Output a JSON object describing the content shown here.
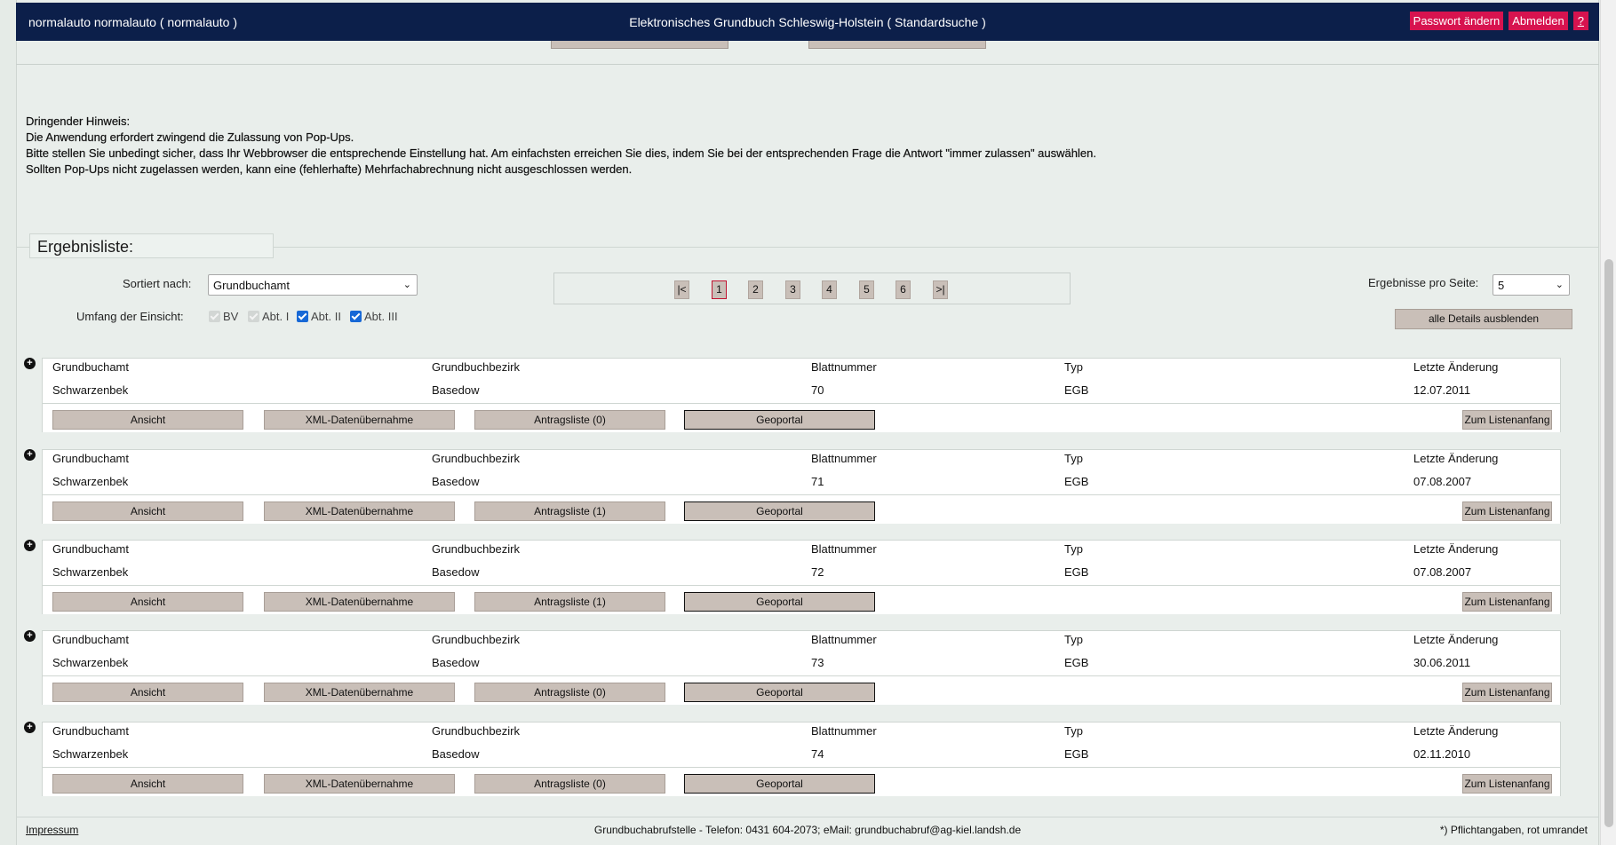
{
  "header": {
    "user": "normalauto normalauto  ( normalauto )",
    "title": "Elektronisches Grundbuch Schleswig-Holstein  ( Standardsuche )",
    "change_password": "Passwort ändern",
    "logout": "Abmelden",
    "help": "?"
  },
  "notice": {
    "heading": "Dringender Hinweis:",
    "line1": "Die Anwendung erfordert zwingend die Zulassung von Pop-Ups.",
    "line2": "Bitte stellen Sie unbedingt sicher, dass Ihr Webbrowser die entsprechende Einstellung hat. Am einfachsten erreichen Sie dies, indem Sie bei der entsprechenden Frage die Antwort \"immer zulassen\" auswählen.",
    "line3": "Sollten Pop-Ups nicht zugelassen werden, kann eine (fehlerhafte) Mehrfachabrechnung nicht ausgeschlossen werden."
  },
  "results": {
    "legend": "Ergebnisliste:",
    "sort_label": "Sortiert nach:",
    "sort_value": "Grundbuchamt",
    "scope_label": "Umfang der Einsicht:",
    "scope": [
      {
        "label": "BV",
        "checked": true,
        "disabled": true
      },
      {
        "label": "Abt. I",
        "checked": true,
        "disabled": true
      },
      {
        "label": "Abt. II",
        "checked": true,
        "disabled": false
      },
      {
        "label": "Abt. III",
        "checked": true,
        "disabled": false
      }
    ],
    "pager": {
      "first": "|<",
      "pages": [
        "1",
        "2",
        "3",
        "4",
        "5",
        "6"
      ],
      "last": ">|",
      "current": "1"
    },
    "per_page_label": "Ergebnisse pro Seite:",
    "per_page_value": "5",
    "hide_details": "alle Details ausblenden",
    "columns": [
      "Grundbuchamt",
      "Grundbuchbezirk",
      "Blattnummer",
      "Typ",
      "Letzte Änderung"
    ],
    "records": [
      {
        "amt": "Schwarzenbek",
        "bezirk": "Basedow",
        "blatt": "70",
        "typ": "EGB",
        "datum": "12.07.2011",
        "antrag": "Antragsliste (0)"
      },
      {
        "amt": "Schwarzenbek",
        "bezirk": "Basedow",
        "blatt": "71",
        "typ": "EGB",
        "datum": "07.08.2007",
        "antrag": "Antragsliste (1)"
      },
      {
        "amt": "Schwarzenbek",
        "bezirk": "Basedow",
        "blatt": "72",
        "typ": "EGB",
        "datum": "07.08.2007",
        "antrag": "Antragsliste (1)"
      },
      {
        "amt": "Schwarzenbek",
        "bezirk": "Basedow",
        "blatt": "73",
        "typ": "EGB",
        "datum": "30.06.2011",
        "antrag": "Antragsliste (0)"
      },
      {
        "amt": "Schwarzenbek",
        "bezirk": "Basedow",
        "blatt": "74",
        "typ": "EGB",
        "datum": "02.11.2010",
        "antrag": "Antragsliste (0)"
      }
    ],
    "row_buttons": {
      "view": "Ansicht",
      "xml": "XML-Datenübernahme",
      "geo": "Geoportal",
      "top": "Zum Listenanfang"
    }
  },
  "footer": {
    "impressum": "Impressum",
    "contact": "Grundbuchabrufstelle - Telefon: 0431 604-2073; eMail: grundbuchabruf@ag-kiel.landsh.de",
    "required": "*) Pflichtangaben, rot umrandet"
  },
  "colors": {
    "header_bg": "#0c1f4a",
    "accent": "#d7134f",
    "button_bg": "#c9bfb8",
    "page_bg": "#e9eeeb"
  }
}
